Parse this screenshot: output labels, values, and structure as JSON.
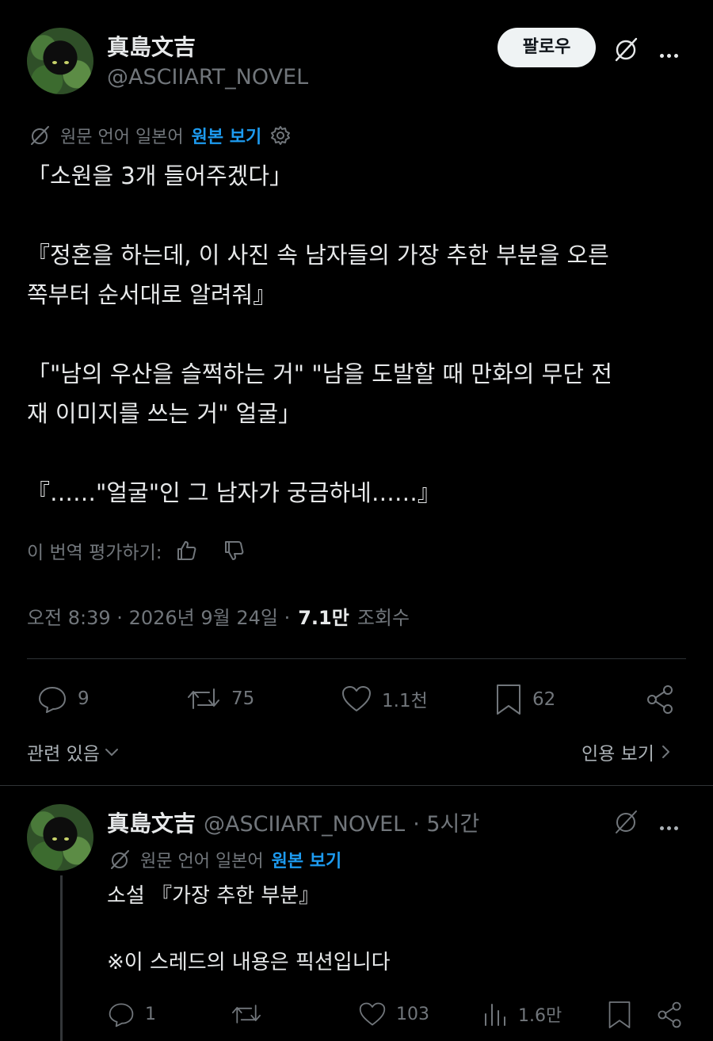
{
  "main_tweet": {
    "author_name": "真島文吉",
    "author_handle": "@ASCIIART_NOVEL",
    "follow_label": "팔로우",
    "translation_note": "원문 언어 일본어",
    "view_original_label": "원본 보기",
    "text": "「소원을 3개 들어주겠다」\n\n『정혼을 하는데, 이 사진 속 남자들의 가장 추한 부분을 오른\n쪽부터 순서대로 알려줘』\n\n「\"남의 우산을 슬쩍하는 거\" \"남을 도발할 때 만화의 무단 전\n재 이미지를 쓰는 거\" 얼굴」\n\n『……\"얼굴\"인 그 남자가 궁금하네……』",
    "rate_translation_label": "이 번역 평가하기:",
    "timestamp": "오전 8:39 · 2026년 9월 24일 ·",
    "views_count": "7.1만",
    "views_label": "조회수",
    "replies": "9",
    "reposts": "75",
    "likes": "1.1천",
    "bookmarks": "62",
    "related_label": "관련 있음",
    "quotes_label": "인용 보기"
  },
  "reply_tweet": {
    "author_name": "真島文吉",
    "author_handle": "@ASCIIART_NOVEL",
    "time": "· 5시간",
    "translation_note": "원문 언어 일본어",
    "view_original_label": "원본 보기",
    "text": "소설 『가장 추한 부분』\n\n※이 스레드의 내용은 픽션입니다",
    "replies": "1",
    "reposts": "",
    "likes": "103",
    "views": "1.6만"
  },
  "colors": {
    "background": "#000000",
    "text": "#e7e9ea",
    "muted": "#71767b",
    "accent": "#1d9bf0"
  },
  "icons": [
    "grok-icon",
    "more-icon",
    "translate-icon",
    "gear-icon",
    "thumbs-up-icon",
    "thumbs-down-icon",
    "reply-icon",
    "repost-icon",
    "like-icon",
    "bookmark-icon",
    "share-icon",
    "chevron-down-icon",
    "chevron-right-icon",
    "views-icon"
  ]
}
